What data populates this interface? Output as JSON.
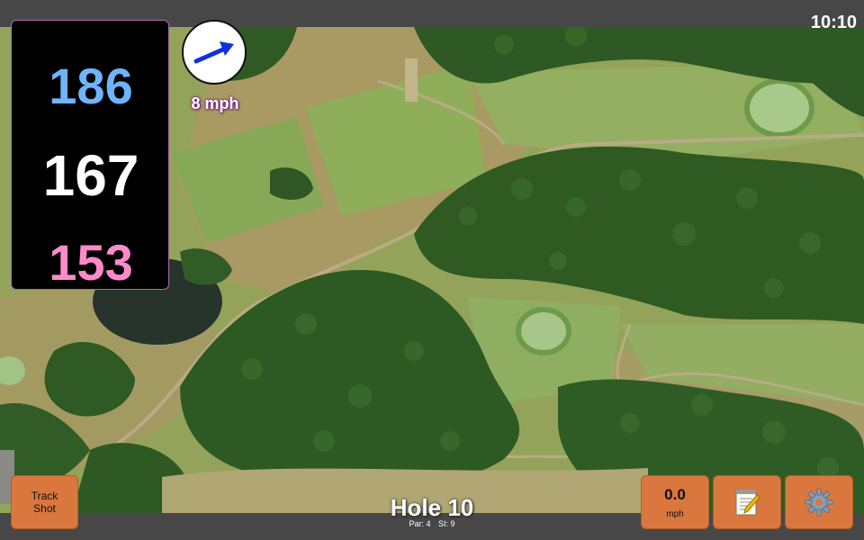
{
  "status": {
    "time": "10:10"
  },
  "distances": {
    "back": "186",
    "middle": "167",
    "front": "153"
  },
  "wind": {
    "speed_label": "8 mph",
    "arrow_icon": "wind-direction-arrow-icon"
  },
  "hole": {
    "title": "Hole 10",
    "par": "Par: 4",
    "stroke_index": "SI: 9"
  },
  "buttons": {
    "track_shot_line1": "Track",
    "track_shot_line2": "Shot",
    "wind_value": "0.0",
    "wind_unit": "mph",
    "notes_icon": "notepad-icon",
    "settings_icon": "gear-icon"
  },
  "colors": {
    "back_distance": "#6fb4ff",
    "middle_distance": "#ffffff",
    "front_distance": "#ff8acb",
    "button_orange": "#d9773e",
    "wind_label_outline": "#7a1e80"
  }
}
